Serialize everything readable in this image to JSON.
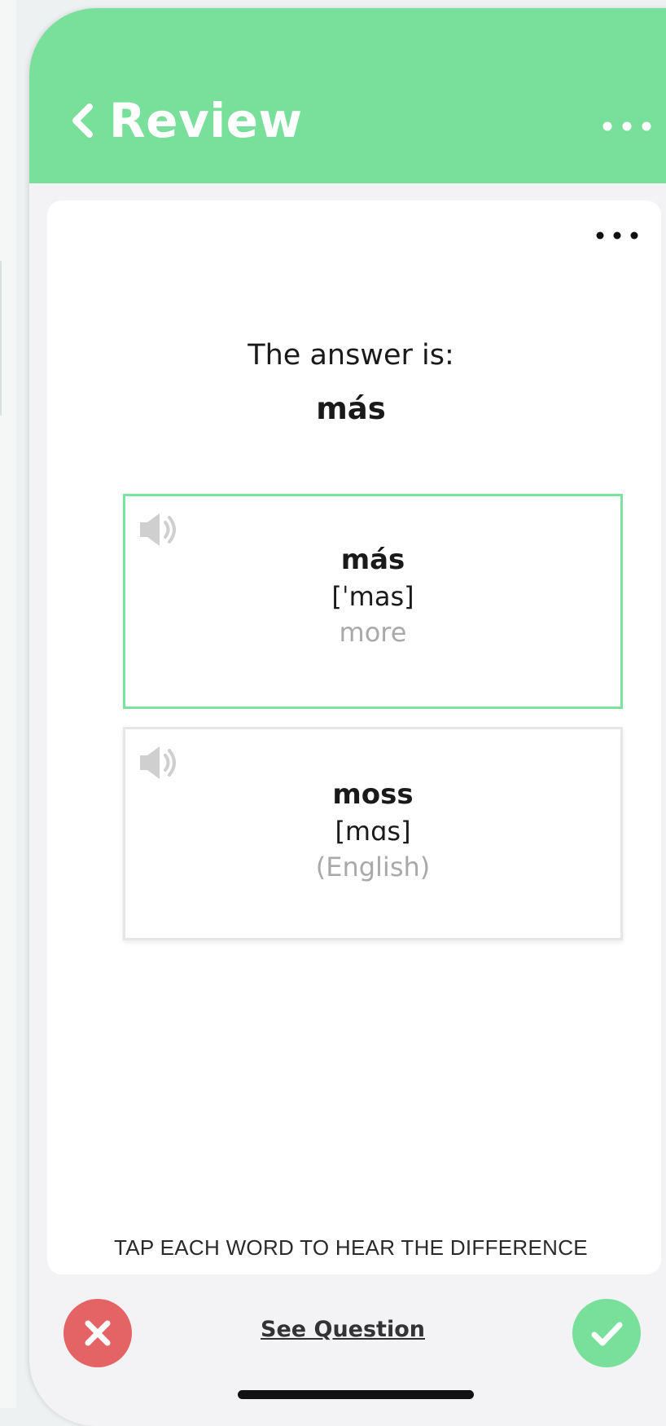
{
  "header": {
    "back_icon": "chevron-left-icon",
    "title": "Review",
    "more_icon": "more-horizontal-icon",
    "background_color": "#78e09a"
  },
  "card": {
    "more_icon": "more-horizontal-icon",
    "answer_label": "The answer is:",
    "answer_word": "más",
    "words": [
      {
        "word": "más",
        "ipa": "[ˈmas]",
        "gloss": "more",
        "state": "correct",
        "border_color": "#7be3a0",
        "icon": "speaker-icon"
      },
      {
        "word": "moss",
        "ipa": "[mɑs]",
        "gloss": "(English)",
        "state": "other",
        "border_color": "#e6e6e6",
        "icon": "speaker-icon"
      }
    ],
    "hint": "TAP EACH WORD TO HEAR THE DIFFERENCE"
  },
  "footer": {
    "reject_icon": "close-icon",
    "reject_color": "#e46465",
    "see_question_label": "See Question",
    "accept_icon": "check-icon",
    "accept_color": "#78e09a"
  }
}
